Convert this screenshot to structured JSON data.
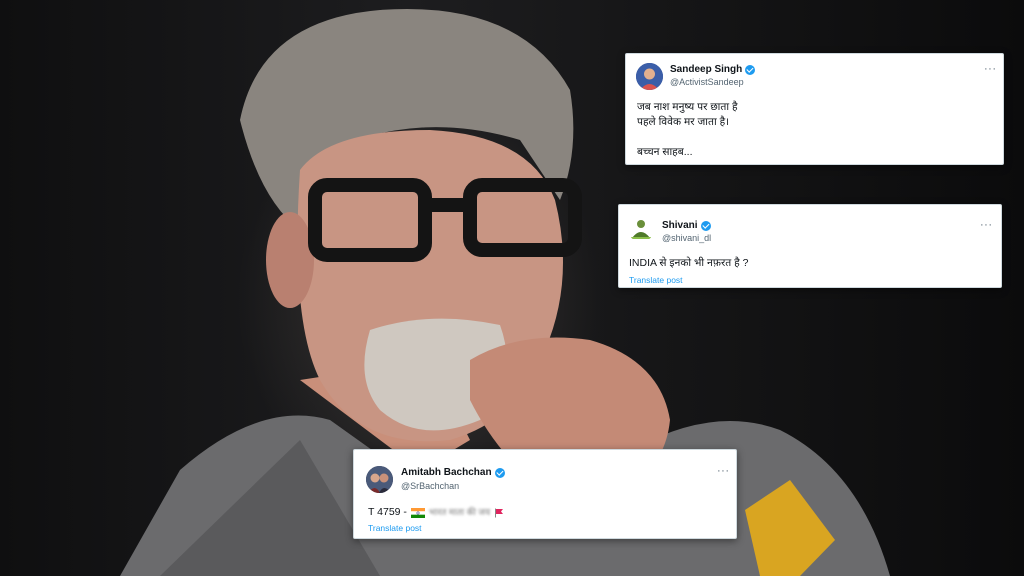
{
  "tweets": {
    "sandeep": {
      "name": "Sandeep Singh",
      "handle": "@ActivistSandeep",
      "more": "···",
      "lines": [
        "जब नाश मनुष्य पर छाता है",
        "पहले विवेक मर जाता है।",
        "",
        "बच्चन साहब..."
      ]
    },
    "shivani": {
      "name": "Shivani",
      "handle": "@shivani_dl",
      "more": "···",
      "text": "INDIA से इनको भी नफ़रत है ?",
      "translate": "Translate post"
    },
    "amitabh": {
      "name": "Amitabh Bachchan",
      "handle": "@SrBachchan",
      "more": "···",
      "text_prefix": "T 4759 -",
      "text_blurred": "भारत माता की जय",
      "translate": "Translate post"
    }
  },
  "colors": {
    "verified": "#1d9bf0",
    "link": "#1d9bf0",
    "handle": "#536471"
  },
  "icons": {
    "verified": "verified-badge-icon",
    "more": "more-options-icon",
    "flag_india": "india-flag-icon",
    "flag_red": "red-flag-icon"
  }
}
